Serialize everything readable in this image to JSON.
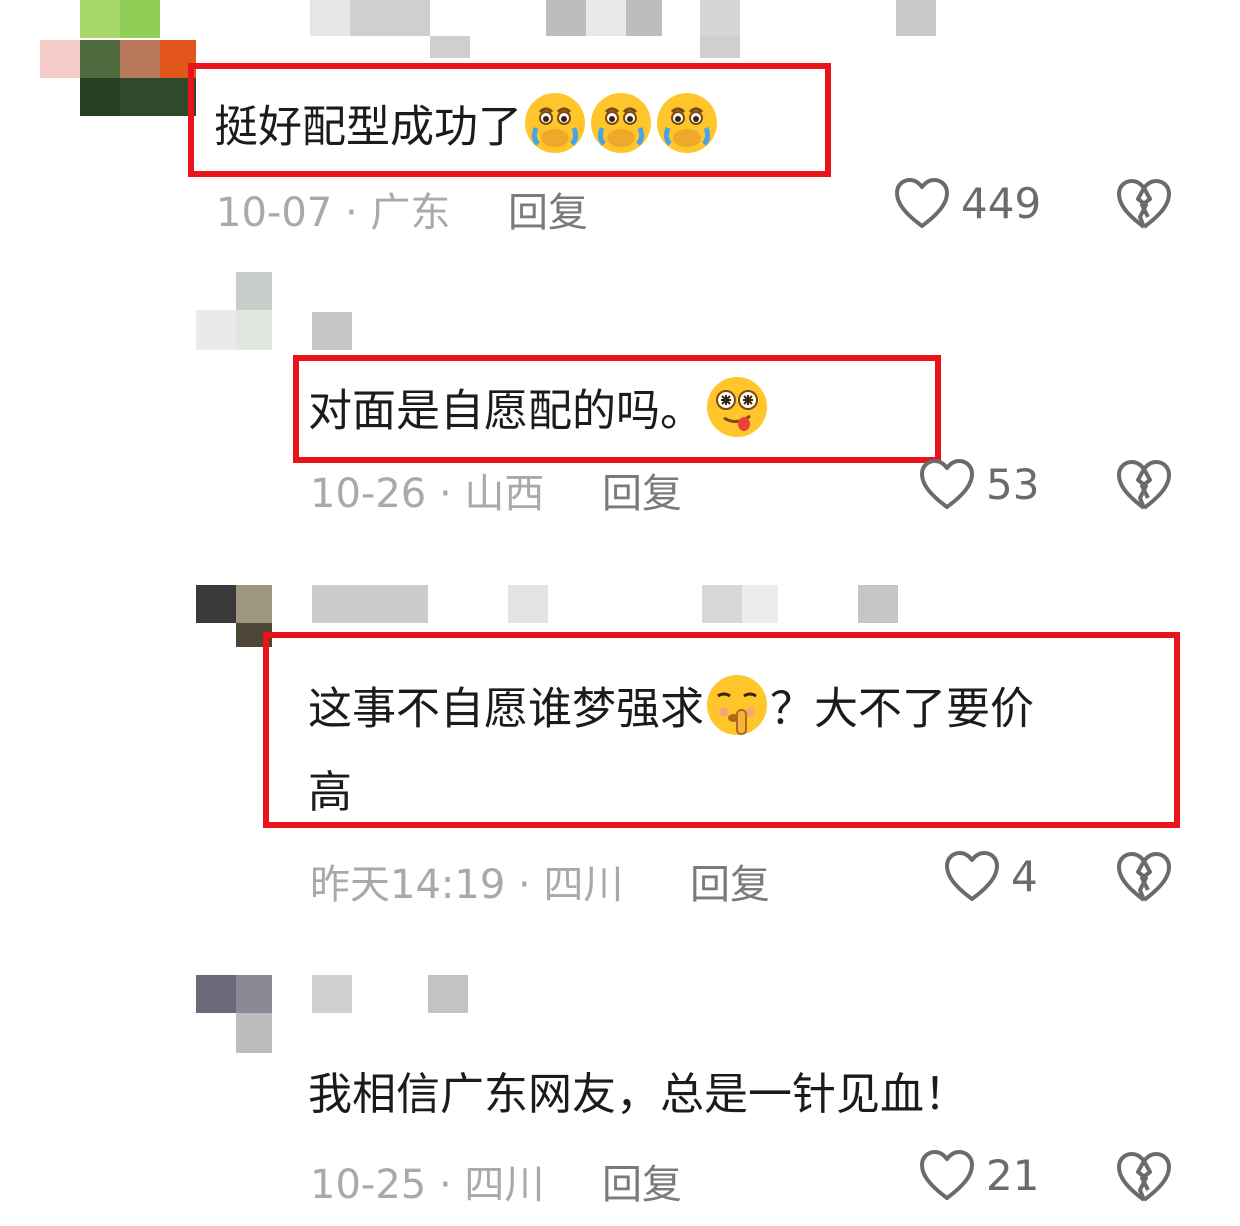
{
  "comments": [
    {
      "text": "挺好配型成功了",
      "emojis": [
        "crying-face-emoji",
        "crying-face-emoji",
        "crying-face-emoji"
      ],
      "date": "10-07",
      "location": "广东",
      "reply_label": "回复",
      "likes": "449"
    },
    {
      "text": "对面是自愿配的吗。",
      "emojis": [
        "dizzy-tongue-face-emoji"
      ],
      "date": "10-26",
      "location": "山西",
      "reply_label": "回复",
      "likes": "53"
    },
    {
      "text_part1": "这事不自愿谁梦强求",
      "text_part2": "？大不了要价",
      "text_line2": "高",
      "emojis": [
        "shushing-face-emoji"
      ],
      "date": "昨天14:19",
      "location": "四川",
      "reply_label": "回复",
      "likes": "4"
    },
    {
      "text": "我相信广东网友，总是一针见血！",
      "date": "10-25",
      "location": "四川",
      "reply_label": "回复",
      "likes": "21"
    }
  ],
  "separator": "·",
  "colors": {
    "highlight": "#e8131b",
    "meta_text": "#a9a9a9",
    "reply_text": "#7a7a7a",
    "emoji_yellow": "#ffc62b"
  }
}
